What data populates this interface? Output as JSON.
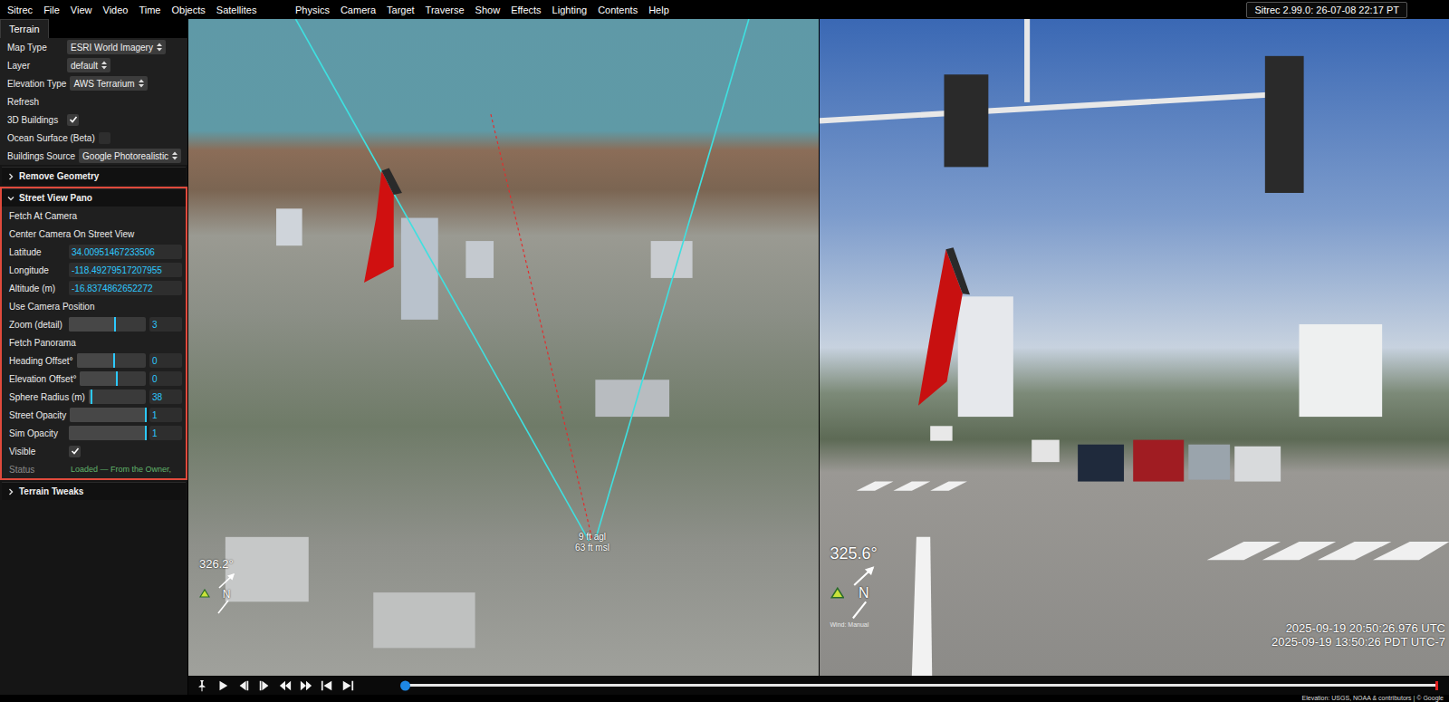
{
  "menu_bar": {
    "app_menus": [
      {
        "label": "Sitrec"
      },
      {
        "label": "File"
      },
      {
        "label": "View"
      },
      {
        "label": "Video"
      },
      {
        "label": "Time"
      },
      {
        "label": "Objects"
      },
      {
        "label": "Satellites"
      }
    ],
    "view_menus": [
      {
        "label": "Physics"
      },
      {
        "label": "Camera"
      },
      {
        "label": "Target"
      },
      {
        "label": "Traverse"
      },
      {
        "label": "Show"
      },
      {
        "label": "Effects"
      },
      {
        "label": "Lighting"
      },
      {
        "label": "Contents"
      },
      {
        "label": "Help"
      }
    ],
    "version": "Sitrec 2.99.0: 26-07-08 22:17 PT"
  },
  "sidebar": {
    "tabs": [
      {
        "label": "Terrain",
        "selected": true
      }
    ],
    "rows": [
      {
        "kind": "select",
        "label": "Map Type",
        "value": "ESRI World Imagery"
      },
      {
        "kind": "select",
        "label": "Layer",
        "value": "default"
      },
      {
        "kind": "select",
        "label": "Elevation Type",
        "value": "AWS Terrarium"
      },
      {
        "kind": "button",
        "label": "Refresh"
      },
      {
        "kind": "checkbox",
        "label": "3D Buildings",
        "checked": true
      },
      {
        "kind": "checkbox",
        "label": "Ocean Surface (Beta)",
        "checked": false
      },
      {
        "kind": "select",
        "label": "Buildings Source",
        "value": "Google Photorealistic"
      }
    ],
    "folders": [
      {
        "label": "Remove Geometry",
        "expanded": false,
        "highlighted": false,
        "rows": []
      },
      {
        "label": "Street View Pano",
        "expanded": true,
        "highlighted": true,
        "rows": [
          {
            "kind": "button",
            "label": "Fetch At Camera"
          },
          {
            "kind": "button",
            "label": "Center Camera On Street View"
          },
          {
            "kind": "number",
            "label": "Latitude",
            "value": "34.00951467233506"
          },
          {
            "kind": "number",
            "label": "Longitude",
            "value": "-118.49279517207955"
          },
          {
            "kind": "number",
            "label": "Altitude (m)",
            "value": "-16.8374862652272"
          },
          {
            "kind": "button",
            "label": "Use Camera Position"
          },
          {
            "kind": "slider",
            "label": "Zoom (detail)",
            "value": "3",
            "level": 0.6
          },
          {
            "kind": "button",
            "label": "Fetch Panorama"
          },
          {
            "kind": "slider",
            "label": "Heading Offset°",
            "value": "0",
            "level": 0.54
          },
          {
            "kind": "slider",
            "label": "Elevation Offset°",
            "value": "0",
            "level": 0.56
          },
          {
            "kind": "slider",
            "label": "Sphere Radius (m)",
            "value": "38",
            "level": 0.05
          },
          {
            "kind": "slider",
            "label": "Street Opacity",
            "value": "1",
            "level": 1
          },
          {
            "kind": "slider",
            "label": "Sim Opacity",
            "value": "1",
            "level": 1
          },
          {
            "kind": "checkbox",
            "label": "Visible",
            "checked": true
          },
          {
            "kind": "status",
            "label": "Status",
            "value": "Loaded — From the Owner,",
            "disabled": true
          }
        ]
      },
      {
        "label": "Terrain Tweaks",
        "expanded": false,
        "highlighted": false,
        "rows": []
      }
    ]
  },
  "views": {
    "sim_view": {
      "heading": "326.2°",
      "north_label": "N",
      "altitude_label": [
        "9 ft agl",
        "63 ft msl"
      ]
    },
    "street_view": {
      "heading": "325.6°",
      "north_label": "N",
      "wind": "Wind: Manual",
      "times": [
        "2025-09-19 20:50:26.976 UTC",
        "2025-09-19 13:50:26 PDT UTC-7"
      ]
    }
  },
  "playback": {
    "timeline": {
      "level": 0
    }
  },
  "status_bar": {
    "text": "Elevation: USGS, NOAA & contributors | © Google"
  }
}
